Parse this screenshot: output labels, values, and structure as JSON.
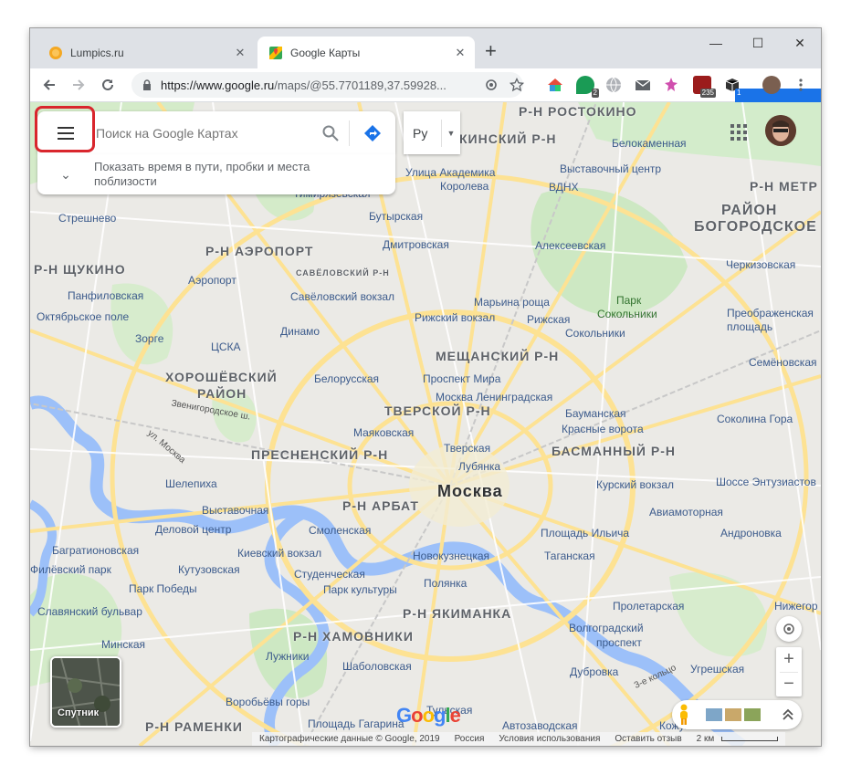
{
  "browser": {
    "tabs": [
      {
        "title": "Lumpics.ru",
        "close": "✕"
      },
      {
        "title": "Google Карты",
        "close": "✕"
      }
    ],
    "new_tab": "+",
    "window": {
      "minimize": "—",
      "maximize": "☐",
      "close": "✕"
    },
    "url_host": "https://www.google.ru",
    "url_rest": "/maps/@55.7701189,37.59928...",
    "extension_badges": {
      "green": "2",
      "calendar": "235",
      "box": "1"
    }
  },
  "search": {
    "placeholder": "Поиск на Google Картах",
    "language": "Ру",
    "suggestion": "Показать время в пути, пробки и места поблизости"
  },
  "satellite_label": "Спутник",
  "footer": {
    "copyright": "Картографические данные © Google, 2019",
    "country": "Россия",
    "terms": "Условия использования",
    "feedback": "Оставить отзыв",
    "scale": "2 км"
  },
  "google_logo": "Google",
  "map_labels": {
    "districts": [
      "Р-Н РОСТОКИНО",
      "КИНСКИЙ Р-Н",
      "Р-Н МЕТР",
      "РАЙОН",
      "БОГОРОДСКОЕ",
      "Р-Н АЭРОПОРТ",
      "Р-Н ЩУКИНО",
      "САВЁЛОВСКИЙ Р-Н",
      "МЕЩАНСКИЙ Р-Н",
      "ХОРОШЁВСКИЙ",
      "РАЙОН",
      "ТВЕРСКОЙ Р-Н",
      "ПРЕСНЕНСКИЙ Р-Н",
      "БАСМАННЫЙ Р-Н",
      "Р-Н АРБАТ",
      "Р-Н ЯКИМАНКА",
      "Р-Н ХАМОВНИКИ",
      "Р-Н РАМЕНКИ"
    ],
    "city": "Москва",
    "places": [
      "Белокаменная",
      "Выставочный центр",
      "ВДНХ",
      "Улица Академика",
      "Королева",
      "Тимирязевская",
      "Бутырская",
      "Стрешнево",
      "Дмитровская",
      "Алексеевская",
      "Черкизовская",
      "Панфиловская",
      "Аэропорт",
      "Савёловский вокзал",
      "Марьина роща",
      "Парк",
      "Сокольники",
      "Преображенская",
      "площадь",
      "Октябрьское поле",
      "Динамо",
      "Рижский вокзал",
      "Рижская",
      "Сокольники",
      "Зорге",
      "ЦСКА",
      "Семёновская",
      "Белорусская",
      "Проспект Мира",
      "Москва Ленинградская",
      "Бауманская",
      "Красные ворота",
      "Соколина Гора",
      "Маяковская",
      "Тверская",
      "Лубянка",
      "Курский вокзал",
      "Шелепиха",
      "Шоссе Энтузиастов",
      "Выставочная",
      "Авиамоторная",
      "Деловой центр",
      "Смоленская",
      "Площадь Ильича",
      "Андроновка",
      "Багратионовская",
      "Киевский вокзал",
      "Новокузнецкая",
      "Таганская",
      "Филёвский парк",
      "Кутузовская",
      "Студенческая",
      "Полянка",
      "Парк Победы",
      "Парк культуры",
      "Пролетарская",
      "Славянский бульвар",
      "Нижегор",
      "Волгоградский",
      "проспект",
      "Минская",
      "Лужники",
      "Шаболовская",
      "Дубровка",
      "Угрешская",
      "Воробьёвы горы",
      "Площадь Гагарина",
      "Автозаводская",
      "Тульская",
      "Кожуховская",
      "Звенигородское ш.",
      "ул. Москва",
      "3-е кольцо"
    ]
  }
}
